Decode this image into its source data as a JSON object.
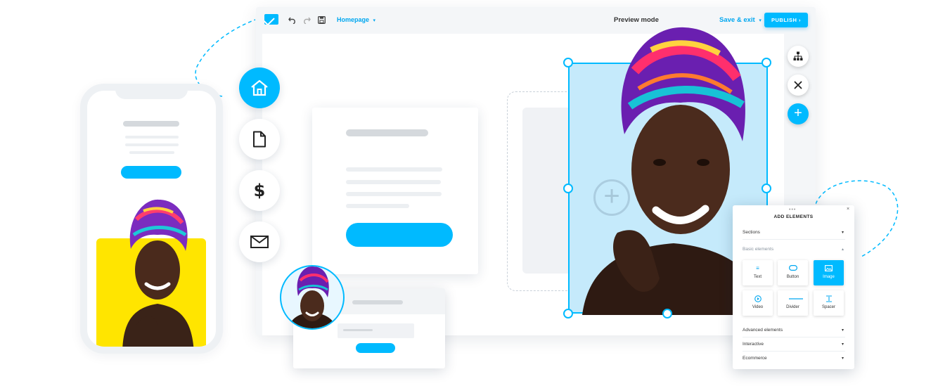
{
  "editor": {
    "page_select": "Homepage",
    "page_select_caret": "▾",
    "preview_mode": "Preview mode",
    "save_exit": "Save & exit",
    "save_exit_caret": "▾",
    "publish": "PUBLISH ›",
    "toolbar_icons": [
      "logo-envelope-icon",
      "undo-icon",
      "redo-icon",
      "save-icon"
    ]
  },
  "right_rail": [
    "sitemap-icon",
    "close-icon",
    "plus-icon"
  ],
  "left_nav": [
    "home-icon",
    "page-icon",
    "dollar-icon",
    "envelope-icon"
  ],
  "add_elements": {
    "title": "ADD ELEMENTS",
    "sections": "Sections",
    "basic_elements": "Basic elements",
    "tiles": [
      {
        "label": "Text",
        "icon": "text-icon"
      },
      {
        "label": "Button",
        "icon": "button-icon"
      },
      {
        "label": "Image",
        "icon": "image-icon"
      },
      {
        "label": "Video",
        "icon": "video-icon"
      },
      {
        "label": "Divider",
        "icon": "divider-icon"
      },
      {
        "label": "Spacer",
        "icon": "spacer-icon"
      }
    ],
    "advanced_elements": "Advanced elements",
    "interactive": "Interactive",
    "ecommerce": "Ecommerce",
    "chevron_down": "▾",
    "chevron_up": "▴",
    "close": "×",
    "dots": "•••"
  },
  "colors": {
    "accent": "#00baff",
    "selection_fill": "#c5eafb",
    "phone_accent_block": "#ffe500",
    "placeholder_bar": "#d5d9dd",
    "placeholder_line": "#eceff2"
  }
}
